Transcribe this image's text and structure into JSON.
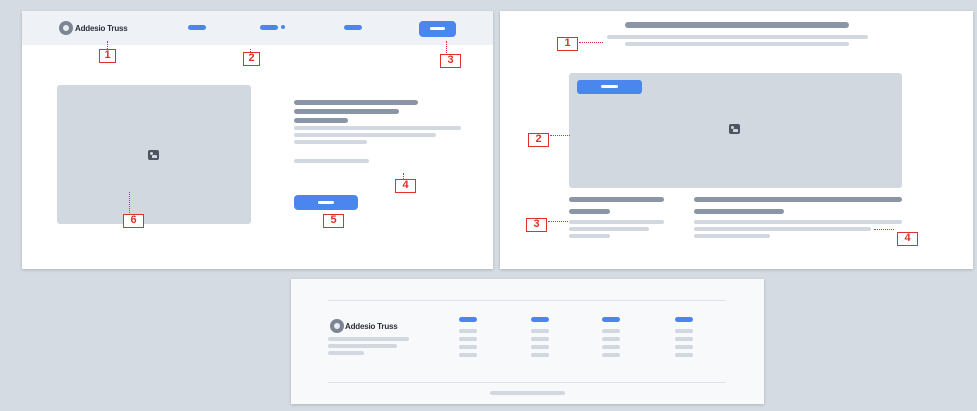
{
  "header": {
    "logo_text": "Addesio Truss",
    "nav_links": 3,
    "cta_button": "button"
  },
  "footer": {
    "logo_text": "Addesio Truss"
  },
  "panel1_badges": [
    "1",
    "2",
    "3",
    "4",
    "5",
    "6"
  ],
  "panel2_badges": [
    "1",
    "2",
    "3",
    "4"
  ],
  "colors": {
    "accent": "#4b86ef",
    "placeholder": "#d2d8e0",
    "text_bar": "#8a95a5",
    "annotation": "#e0302a",
    "background": "#d5dbe3"
  },
  "icons": [
    "logo-icon",
    "image-placeholder-icon"
  ]
}
